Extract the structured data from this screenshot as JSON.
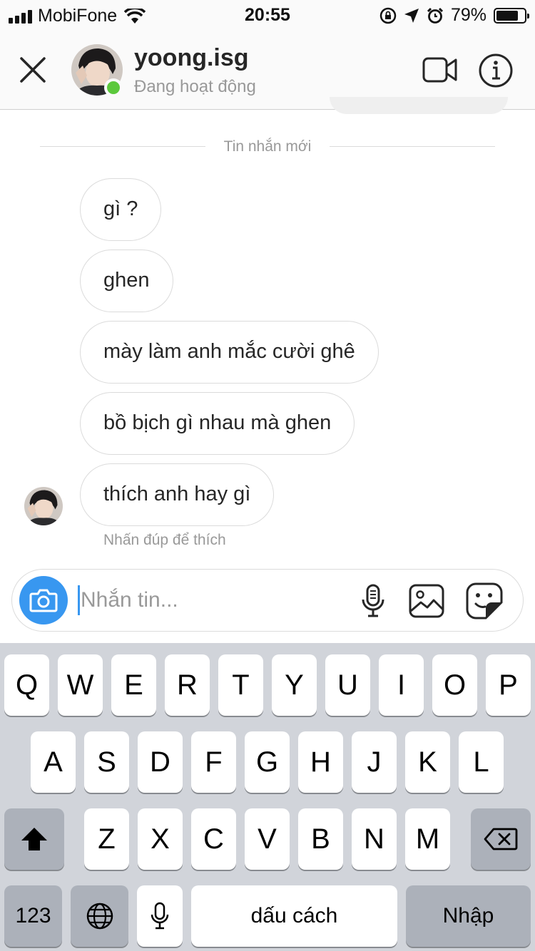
{
  "status_bar": {
    "carrier": "MobiFone",
    "time": "20:55",
    "battery_percent": "79%",
    "battery_level": 0.79,
    "icons": [
      "signal-icon",
      "wifi-icon",
      "orientation-lock-icon",
      "location-icon",
      "alarm-icon",
      "battery-icon"
    ]
  },
  "header": {
    "username": "yoong.isg",
    "status": "Đang hoạt động",
    "online": true,
    "icons": [
      "close-icon",
      "video-call-icon",
      "info-icon"
    ]
  },
  "conversation": {
    "divider_label": "Tin nhắn mới",
    "messages": [
      {
        "text": "gì ?"
      },
      {
        "text": "ghen"
      },
      {
        "text": "mày làm anh mắc cười ghê"
      },
      {
        "text": "bồ bịch gì nhau mà ghen"
      },
      {
        "text": "thích anh hay gì"
      }
    ],
    "double_tap_hint": "Nhấn đúp để thích"
  },
  "composer": {
    "value": "",
    "placeholder": "Nhắn tin...",
    "icons": [
      "camera-icon",
      "microphone-icon",
      "gallery-icon",
      "sticker-icon"
    ]
  },
  "keyboard": {
    "row1": [
      "Q",
      "W",
      "E",
      "R",
      "T",
      "Y",
      "U",
      "I",
      "O",
      "P"
    ],
    "row2": [
      "A",
      "S",
      "D",
      "F",
      "G",
      "H",
      "J",
      "K",
      "L"
    ],
    "row3": [
      "Z",
      "X",
      "C",
      "V",
      "B",
      "N",
      "M"
    ],
    "numbers_label": "123",
    "space_label": "dấu cách",
    "return_label": "Nhập",
    "icons": [
      "shift-icon",
      "backspace-icon",
      "globe-icon",
      "dictation-icon"
    ]
  },
  "colors": {
    "accent": "#3897f0",
    "online": "#5cc83c",
    "keyboard_bg": "#d1d4da",
    "dark_key": "#acb1ba"
  }
}
